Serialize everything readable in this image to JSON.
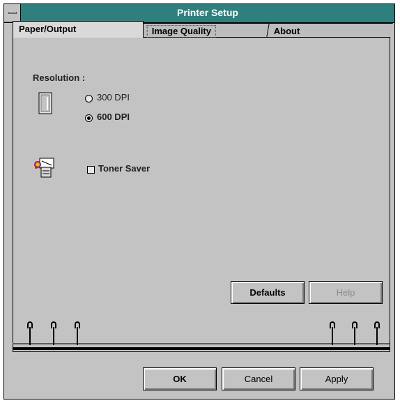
{
  "window": {
    "title": "Printer Setup"
  },
  "tabs": [
    {
      "label": "Paper/Output"
    },
    {
      "label": "Image Quality"
    },
    {
      "label": "About"
    }
  ],
  "resolution": {
    "label": "Resolution :",
    "options": [
      {
        "label": "300 DPI",
        "selected": false
      },
      {
        "label": "600 DPI",
        "selected": true
      }
    ]
  },
  "toner": {
    "label": "Toner Saver",
    "checked": false
  },
  "panel_buttons": {
    "defaults": "Defaults",
    "help": "Help"
  },
  "dialog_buttons": {
    "ok": "OK",
    "cancel": "Cancel",
    "apply": "Apply"
  },
  "icons": {
    "resolution": "printer-page-icon",
    "toner": "toner-cartridge-icon",
    "sysmenu": "system-menu-icon"
  }
}
